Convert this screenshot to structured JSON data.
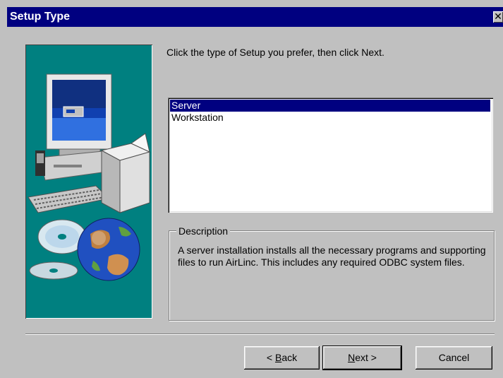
{
  "window": {
    "title": "Setup Type",
    "close_glyph": "✕"
  },
  "illustration": {
    "icons": [
      "computer-icon",
      "cd-icon",
      "globe-icon",
      "box-icon"
    ],
    "background_color": "#008080"
  },
  "instruction": "Click the type of Setup you prefer, then click Next.",
  "setup_types": {
    "items": [
      {
        "label": "Server",
        "selected": true
      },
      {
        "label": "Workstation",
        "selected": false
      }
    ]
  },
  "description": {
    "legend": "Description",
    "text": "A server installation installs all the necessary programs and supporting files to run AirLinc.  This includes any required ODBC system files."
  },
  "buttons": {
    "back": {
      "prefix": "< ",
      "mnemonic": "B",
      "rest": "ack"
    },
    "next": {
      "mnemonic": "N",
      "rest": "ext >"
    },
    "cancel": "Cancel"
  },
  "colors": {
    "title_bar": "#000080",
    "selection": "#000080",
    "face": "#c0c0c0"
  }
}
